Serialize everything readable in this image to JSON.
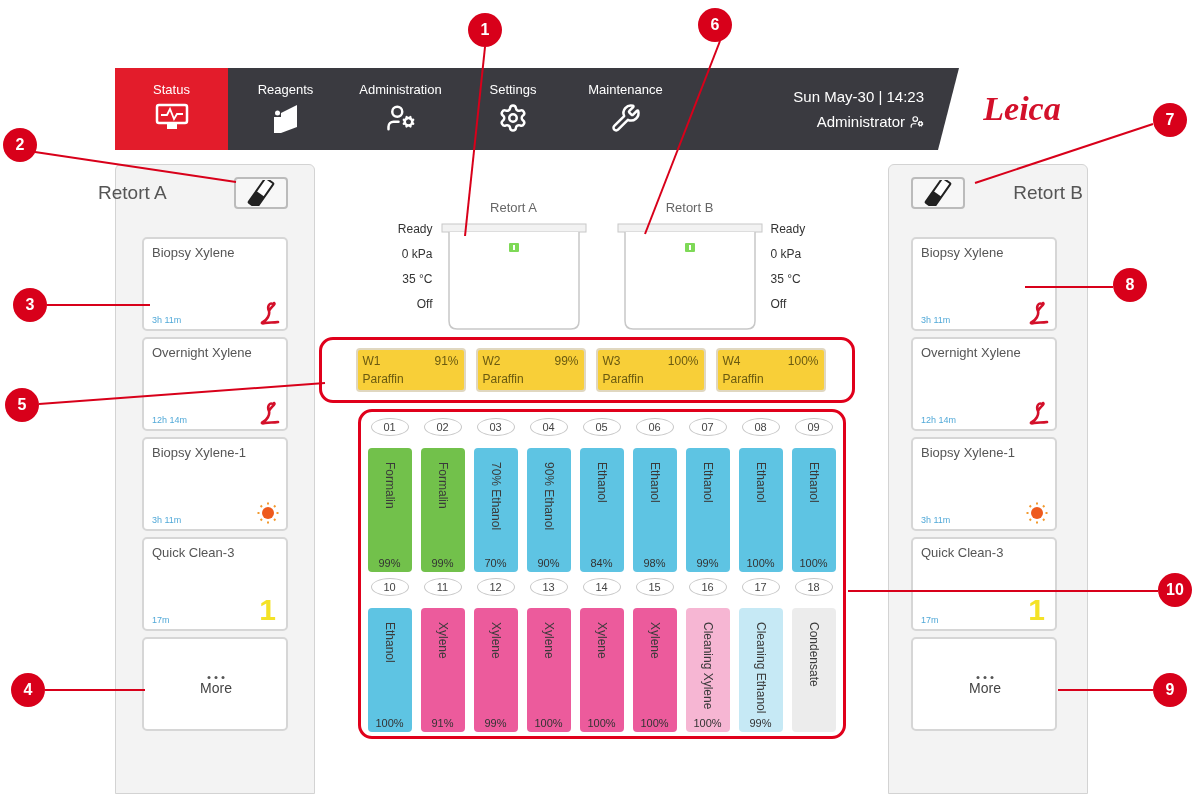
{
  "nav": {
    "tabs": [
      {
        "label": "Status",
        "selected": true
      },
      {
        "label": "Reagents",
        "selected": false
      },
      {
        "label": "Administration",
        "selected": false
      },
      {
        "label": "Settings",
        "selected": false
      },
      {
        "label": "Maintenance",
        "selected": false
      }
    ],
    "datetime": "Sun May-30 | 14:23",
    "user": "Administrator",
    "logo": "Leica"
  },
  "retort_panels": [
    {
      "title": "Retort A",
      "protocols": [
        {
          "name": "Biopsy Xylene",
          "time": "3h 11m",
          "kind": "leica"
        },
        {
          "name": "Overnight Xylene",
          "time": "12h 14m",
          "kind": "leica"
        },
        {
          "name": "Biopsy Xylene-1",
          "time": "3h 11m",
          "kind": "sun"
        },
        {
          "name": "Quick Clean-3",
          "time": "17m",
          "kind": "number",
          "badge": "1"
        }
      ],
      "more": "More"
    },
    {
      "title": "Retort B",
      "protocols": [
        {
          "name": "Biopsy Xylene",
          "time": "3h 11m",
          "kind": "leica"
        },
        {
          "name": "Overnight Xylene",
          "time": "12h 14m",
          "kind": "leica"
        },
        {
          "name": "Biopsy Xylene-1",
          "time": "3h 11m",
          "kind": "sun"
        },
        {
          "name": "Quick Clean-3",
          "time": "17m",
          "kind": "number",
          "badge": "1"
        }
      ],
      "more": "More"
    }
  ],
  "retorts": [
    {
      "title": "Retort A",
      "status": [
        "Ready",
        "0 kPa",
        "35 °C",
        "Off"
      ]
    },
    {
      "title": "Retort B",
      "status": [
        "Ready",
        "0 kPa",
        "35 °C",
        "Off"
      ]
    }
  ],
  "wax_baths": [
    {
      "id": "W1",
      "percent": "91%",
      "reagent": "Paraffin"
    },
    {
      "id": "W2",
      "percent": "99%",
      "reagent": "Paraffin"
    },
    {
      "id": "W3",
      "percent": "100%",
      "reagent": "Paraffin"
    },
    {
      "id": "W4",
      "percent": "100%",
      "reagent": "Paraffin"
    }
  ],
  "bottle_rows": [
    [
      {
        "number": "01",
        "reagent": "Formalin",
        "percent": "99%",
        "color": "#72c14b"
      },
      {
        "number": "02",
        "reagent": "Formalin",
        "percent": "99%",
        "color": "#72c14b"
      },
      {
        "number": "03",
        "reagent": "70% Ethanol",
        "percent": "70%",
        "color": "#5ec4e3"
      },
      {
        "number": "04",
        "reagent": "90% Ethanol",
        "percent": "90%",
        "color": "#5ec4e3"
      },
      {
        "number": "05",
        "reagent": "Ethanol",
        "percent": "84%",
        "color": "#5ec4e3"
      },
      {
        "number": "06",
        "reagent": "Ethanol",
        "percent": "98%",
        "color": "#5ec4e3"
      },
      {
        "number": "07",
        "reagent": "Ethanol",
        "percent": "99%",
        "color": "#5ec4e3"
      },
      {
        "number": "08",
        "reagent": "Ethanol",
        "percent": "100%",
        "color": "#5ec4e3"
      },
      {
        "number": "09",
        "reagent": "Ethanol",
        "percent": "100%",
        "color": "#5ec4e3"
      }
    ],
    [
      {
        "number": "10",
        "reagent": "Ethanol",
        "percent": "100%",
        "color": "#5ec4e3"
      },
      {
        "number": "11",
        "reagent": "Xylene",
        "percent": "91%",
        "color": "#ec5b9c"
      },
      {
        "number": "12",
        "reagent": "Xylene",
        "percent": "99%",
        "color": "#ec5b9c"
      },
      {
        "number": "13",
        "reagent": "Xylene",
        "percent": "100%",
        "color": "#ec5b9c"
      },
      {
        "number": "14",
        "reagent": "Xylene",
        "percent": "100%",
        "color": "#ec5b9c"
      },
      {
        "number": "15",
        "reagent": "Xylene",
        "percent": "100%",
        "color": "#ec5b9c"
      },
      {
        "number": "16",
        "reagent": "Cleaning Xylene",
        "percent": "100%",
        "color": "#f6b6d3"
      },
      {
        "number": "17",
        "reagent": "Cleaning Ethanol",
        "percent": "99%",
        "color": "#c6e9f5"
      },
      {
        "number": "18",
        "reagent": "Condensate",
        "color": "#ececec"
      }
    ]
  ],
  "callouts": [
    "6",
    "1",
    "7",
    "2",
    "8",
    "3",
    "5",
    "10",
    "4",
    "9"
  ]
}
